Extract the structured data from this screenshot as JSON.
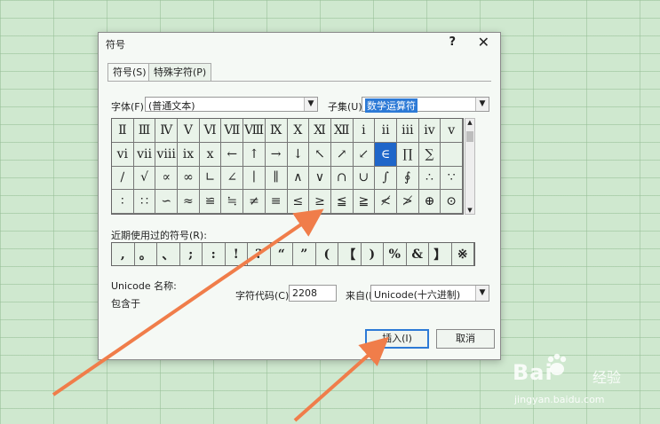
{
  "dialog": {
    "title": "符号",
    "help": "?",
    "close": "✕",
    "tabs": [
      "符号(S)",
      "特殊字符(P)"
    ],
    "font_label": "字体(F):",
    "font_value": "(普通文本)",
    "subset_label": "子集(U):",
    "subset_value": "数学运算符",
    "symbols": [
      [
        "Ⅱ",
        "Ⅲ",
        "Ⅳ",
        "Ⅴ",
        "Ⅵ",
        "Ⅶ",
        "Ⅷ",
        "Ⅸ",
        "Ⅹ",
        "Ⅺ",
        "Ⅻ",
        "ⅰ",
        "ⅱ",
        "ⅲ",
        "ⅳ",
        "ⅴ"
      ],
      [
        "ⅵ",
        "ⅶ",
        "ⅷ",
        "ⅸ",
        "ⅹ",
        "←",
        "↑",
        "→",
        "↓",
        "↖",
        "↗",
        "↙",
        "∈",
        "∏",
        "∑",
        ""
      ],
      [
        "∕",
        "√",
        "∝",
        "∞",
        "∟",
        "∠",
        "∣",
        "∥",
        "∧",
        "∨",
        "∩",
        "∪",
        "∫",
        "∮",
        "∴",
        "∵"
      ],
      [
        "∶",
        "∷",
        "∽",
        "≈",
        "≌",
        "≒",
        "≠",
        "≡",
        "≤",
        "≥",
        "≦",
        "≧",
        "≮",
        "≯",
        "⊕",
        "⊙"
      ]
    ],
    "selected": {
      "row": 1,
      "col": 12
    },
    "recent_label": "近期使用过的符号(R):",
    "recent": [
      ",",
      "。",
      "、",
      ";",
      ":",
      "!",
      "?",
      "“",
      "”",
      "(",
      "【",
      ")",
      "%",
      "&",
      "】",
      "※"
    ],
    "unicode_name_label": "Unicode 名称:",
    "contained_in_label": "包含于",
    "char_code_label": "字符代码(C):",
    "char_code_value": "2208",
    "from_label": "来自(M):",
    "from_value": "Unicode(十六进制)",
    "insert_button": "插入(I)",
    "cancel_button": "取消"
  },
  "watermark": {
    "brand": "Bai",
    "brand_suffix": "经验",
    "url": "jingyan.baidu.com"
  },
  "colors": {
    "arrow": "#f07d4a",
    "selection": "#1f66c9",
    "accent": "#2d7ad6"
  }
}
